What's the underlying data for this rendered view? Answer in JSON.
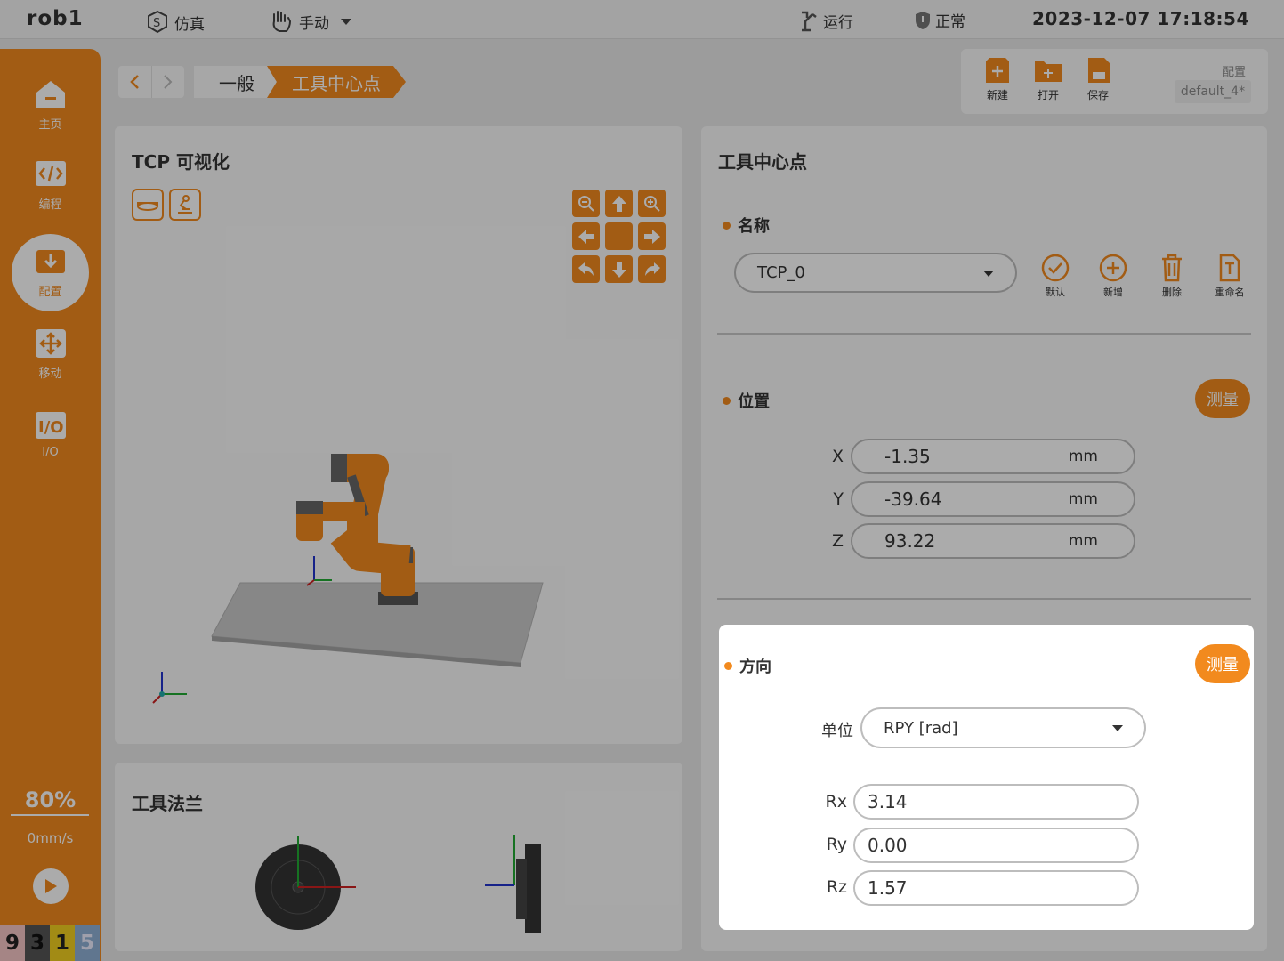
{
  "topbar": {
    "robot_name": "rob1",
    "sim_label": "仿真",
    "mode_label": "手动",
    "run_label": "运行",
    "status_label": "正常",
    "datetime": "2023-12-07 17:18:54"
  },
  "sidebar": {
    "items": [
      {
        "label": "主页",
        "icon": "home-icon"
      },
      {
        "label": "编程",
        "icon": "code-icon"
      },
      {
        "label": "配置",
        "icon": "config-icon"
      },
      {
        "label": "移动",
        "icon": "move-icon"
      },
      {
        "label": "I/O",
        "icon": "io-icon"
      }
    ],
    "speed_percent": "80%",
    "speed_value": "0mm/s",
    "digits": [
      "9",
      "3",
      "1",
      "5"
    ]
  },
  "breadcrumb": {
    "general": "一般",
    "current": "工具中心点"
  },
  "file": {
    "new_label": "新建",
    "open_label": "打开",
    "save_label": "保存",
    "config_label": "配置",
    "config_name": "default_4*"
  },
  "tcp_view": {
    "title": "TCP 可视化"
  },
  "flange": {
    "title": "工具法兰"
  },
  "tcp": {
    "title": "工具中心点",
    "name_label": "名称",
    "selected": "TCP_0",
    "default_label": "默认",
    "add_label": "新增",
    "delete_label": "删除",
    "rename_label": "重命名",
    "position_label": "位置",
    "measure_label": "测量",
    "x_label": "X",
    "x_value": "-1.35",
    "y_label": "Y",
    "y_value": "-39.64",
    "z_label": "Z",
    "z_value": "93.22",
    "unit": "mm",
    "orientation_label": "方向",
    "orientation_measure_label": "测量",
    "unit_label": "单位",
    "unit_selected": "RPY [rad]",
    "rx_label": "Rx",
    "rx_value": "3.14",
    "ry_label": "Ry",
    "ry_value": "0.00",
    "rz_label": "Rz",
    "rz_value": "1.57"
  },
  "colors": {
    "accent": "#f28a1e"
  }
}
